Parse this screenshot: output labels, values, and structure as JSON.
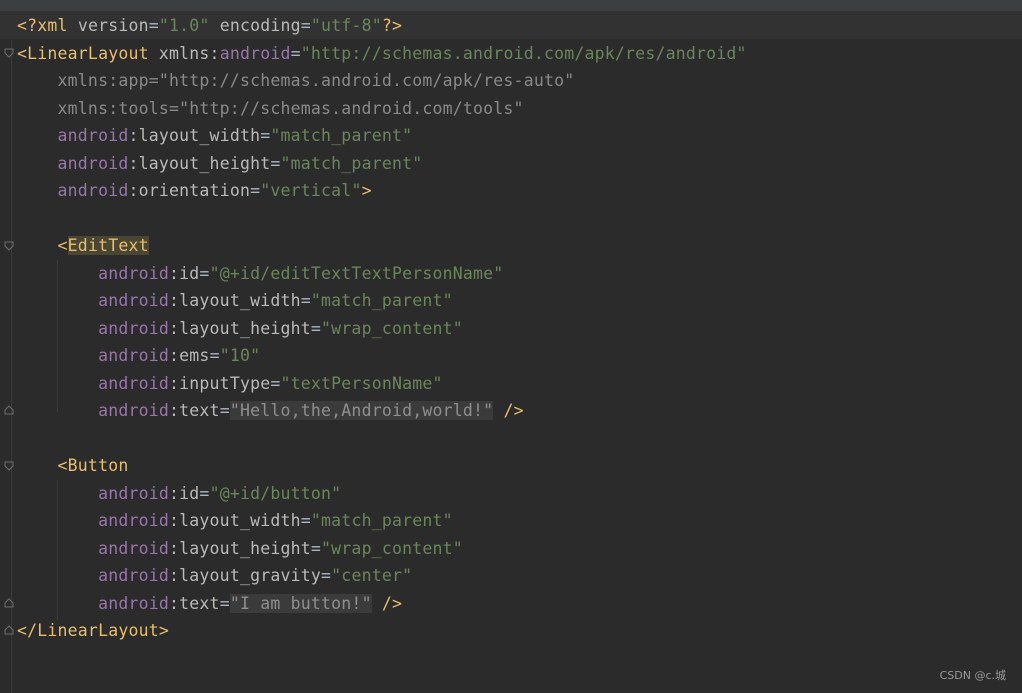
{
  "lines": [
    {
      "tokens": [
        {
          "t": "<?xml ",
          "c": "tok-pi"
        },
        {
          "t": "version",
          "c": "tok-attr"
        },
        {
          "t": "=",
          "c": "tok-punct"
        },
        {
          "t": "\"1.0\"",
          "c": "tok-val"
        },
        {
          "t": " encoding",
          "c": "tok-attr"
        },
        {
          "t": "=",
          "c": "tok-punct"
        },
        {
          "t": "\"utf-8\"",
          "c": "tok-val"
        },
        {
          "t": "?>",
          "c": "tok-pi"
        }
      ]
    },
    {
      "tokens": [
        {
          "t": "<LinearLayout ",
          "c": "tok-tag"
        },
        {
          "t": "xmlns:",
          "c": "tok-attr"
        },
        {
          "t": "android",
          "c": "tok-ns"
        },
        {
          "t": "=",
          "c": "tok-punct"
        },
        {
          "t": "\"http://schemas.android.com/apk/res/android\"",
          "c": "tok-val"
        }
      ]
    },
    {
      "tokens": [
        {
          "t": "    xmlns:app=\"http://schemas.android.com/apk/res-auto\"",
          "c": "tok-dim"
        }
      ]
    },
    {
      "tokens": [
        {
          "t": "    xmlns:tools=\"http://schemas.android.com/tools\"",
          "c": "tok-dim"
        }
      ]
    },
    {
      "tokens": [
        {
          "t": "    android",
          "c": "tok-ns"
        },
        {
          "t": ":layout_width",
          "c": "tok-attr"
        },
        {
          "t": "=",
          "c": "tok-punct"
        },
        {
          "t": "\"match_parent\"",
          "c": "tok-val"
        }
      ]
    },
    {
      "tokens": [
        {
          "t": "    android",
          "c": "tok-ns"
        },
        {
          "t": ":layout_height",
          "c": "tok-attr"
        },
        {
          "t": "=",
          "c": "tok-punct"
        },
        {
          "t": "\"match_parent\"",
          "c": "tok-val"
        }
      ]
    },
    {
      "tokens": [
        {
          "t": "    android",
          "c": "tok-ns"
        },
        {
          "t": ":orientation",
          "c": "tok-attr"
        },
        {
          "t": "=",
          "c": "tok-punct"
        },
        {
          "t": "\"vertical\"",
          "c": "tok-val"
        },
        {
          "t": ">",
          "c": "tok-tag"
        }
      ]
    },
    {
      "tokens": [
        {
          "t": "",
          "c": "tok-punct"
        }
      ]
    },
    {
      "tokens": [
        {
          "t": "    <",
          "c": "tok-tag"
        },
        {
          "t": "EditText",
          "c": "tok-tag tok-hl-tag"
        }
      ]
    },
    {
      "tokens": [
        {
          "t": "        android",
          "c": "tok-ns"
        },
        {
          "t": ":id",
          "c": "tok-attr"
        },
        {
          "t": "=",
          "c": "tok-punct"
        },
        {
          "t": "\"@+id/editTextTextPersonName\"",
          "c": "tok-val"
        }
      ]
    },
    {
      "tokens": [
        {
          "t": "        android",
          "c": "tok-ns"
        },
        {
          "t": ":layout_width",
          "c": "tok-attr"
        },
        {
          "t": "=",
          "c": "tok-punct"
        },
        {
          "t": "\"match_parent\"",
          "c": "tok-val"
        }
      ]
    },
    {
      "tokens": [
        {
          "t": "        android",
          "c": "tok-ns"
        },
        {
          "t": ":layout_height",
          "c": "tok-attr"
        },
        {
          "t": "=",
          "c": "tok-punct"
        },
        {
          "t": "\"wrap_content\"",
          "c": "tok-val"
        }
      ]
    },
    {
      "tokens": [
        {
          "t": "        android",
          "c": "tok-ns"
        },
        {
          "t": ":ems",
          "c": "tok-attr"
        },
        {
          "t": "=",
          "c": "tok-punct"
        },
        {
          "t": "\"10\"",
          "c": "tok-val"
        }
      ]
    },
    {
      "tokens": [
        {
          "t": "        android",
          "c": "tok-ns"
        },
        {
          "t": ":inputType",
          "c": "tok-attr"
        },
        {
          "t": "=",
          "c": "tok-punct"
        },
        {
          "t": "\"textPersonName\"",
          "c": "tok-val"
        }
      ]
    },
    {
      "tokens": [
        {
          "t": "        android",
          "c": "tok-ns"
        },
        {
          "t": ":text",
          "c": "tok-attr"
        },
        {
          "t": "=",
          "c": "tok-punct"
        },
        {
          "t": "\"Hello,the,Android,world!\"",
          "c": "tok-hl-val"
        },
        {
          "t": " />",
          "c": "tok-tag"
        }
      ]
    },
    {
      "tokens": [
        {
          "t": "",
          "c": "tok-punct"
        }
      ]
    },
    {
      "tokens": [
        {
          "t": "    <Button",
          "c": "tok-tag"
        }
      ]
    },
    {
      "tokens": [
        {
          "t": "        android",
          "c": "tok-ns"
        },
        {
          "t": ":id",
          "c": "tok-attr"
        },
        {
          "t": "=",
          "c": "tok-punct"
        },
        {
          "t": "\"@+id/button\"",
          "c": "tok-val"
        }
      ]
    },
    {
      "tokens": [
        {
          "t": "        android",
          "c": "tok-ns"
        },
        {
          "t": ":layout_width",
          "c": "tok-attr"
        },
        {
          "t": "=",
          "c": "tok-punct"
        },
        {
          "t": "\"match_parent\"",
          "c": "tok-val"
        }
      ]
    },
    {
      "tokens": [
        {
          "t": "        android",
          "c": "tok-ns"
        },
        {
          "t": ":layout_height",
          "c": "tok-attr"
        },
        {
          "t": "=",
          "c": "tok-punct"
        },
        {
          "t": "\"wrap_content\"",
          "c": "tok-val"
        }
      ]
    },
    {
      "tokens": [
        {
          "t": "        android",
          "c": "tok-ns"
        },
        {
          "t": ":layout_gravity",
          "c": "tok-attr"
        },
        {
          "t": "=",
          "c": "tok-punct"
        },
        {
          "t": "\"center\"",
          "c": "tok-val"
        }
      ]
    },
    {
      "tokens": [
        {
          "t": "        android",
          "c": "tok-ns"
        },
        {
          "t": ":text",
          "c": "tok-attr"
        },
        {
          "t": "=",
          "c": "tok-punct"
        },
        {
          "t": "\"I am button!\"",
          "c": "tok-hl-val"
        },
        {
          "t": " />",
          "c": "tok-tag"
        }
      ]
    },
    {
      "tokens": [
        {
          "t": "</LinearLayout>",
          "c": "tok-tag"
        }
      ]
    }
  ],
  "watermark": "CSDN @c.城",
  "colors": {
    "background": "#2b2b2b",
    "tag": "#e8bf6a",
    "string": "#6a8759",
    "namespace": "#9876aa",
    "attribute": "#bababa"
  }
}
